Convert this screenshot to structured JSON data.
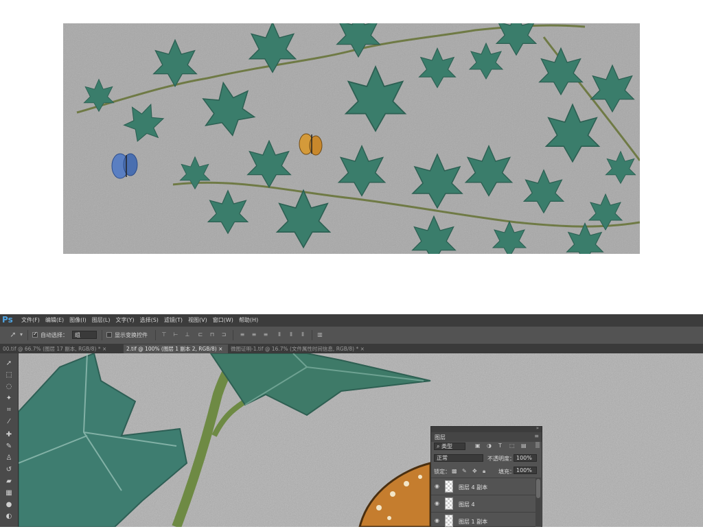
{
  "app": {
    "logo": "Ps"
  },
  "menubar": {
    "items": [
      "文件(F)",
      "编辑(E)",
      "图像(I)",
      "图层(L)",
      "文字(Y)",
      "选择(S)",
      "滤镜(T)",
      "视图(V)",
      "窗口(W)",
      "帮助(H)"
    ]
  },
  "options_bar": {
    "auto_select_label": "自动选择：",
    "auto_select_checked": true,
    "auto_select_target": "组",
    "show_transform_label": "显示变换控件",
    "show_transform_checked": false
  },
  "tabs": [
    {
      "label": "00.tif @ 66.7% (图层 17 副本, RGB/8) *",
      "active": false
    },
    {
      "label": "2.tif @ 100% (图层 1 副本 2, RGB/8)",
      "active": true
    },
    {
      "label": "微图证明-1.tif @ 16.7% (文件属性时间信息, RGB/8) *",
      "active": false
    }
  ],
  "layers_panel": {
    "title": "图层",
    "filter_kind": "类型",
    "blend_mode": "正常",
    "opacity_label": "不透明度：",
    "opacity_value": "100%",
    "lock_label": "锁定：",
    "fill_label": "填充：",
    "fill_value": "100%",
    "layers": [
      {
        "name": "图层 4 副本",
        "visible": true
      },
      {
        "name": "图层 4",
        "visible": true
      },
      {
        "name": "图层 1 副本",
        "visible": true
      }
    ]
  },
  "colors": {
    "ps_background": "#535353",
    "menubar": "#3c3c3c",
    "leaf_dark": "#2f6b58",
    "leaf_light": "#3f8a7a",
    "stone": "#a9a9a9",
    "vine": "#6f7a45"
  },
  "icons": {
    "logo": "ps-logo-icon",
    "move": "move-tool-icon",
    "layer_visibility": "eye-icon"
  }
}
